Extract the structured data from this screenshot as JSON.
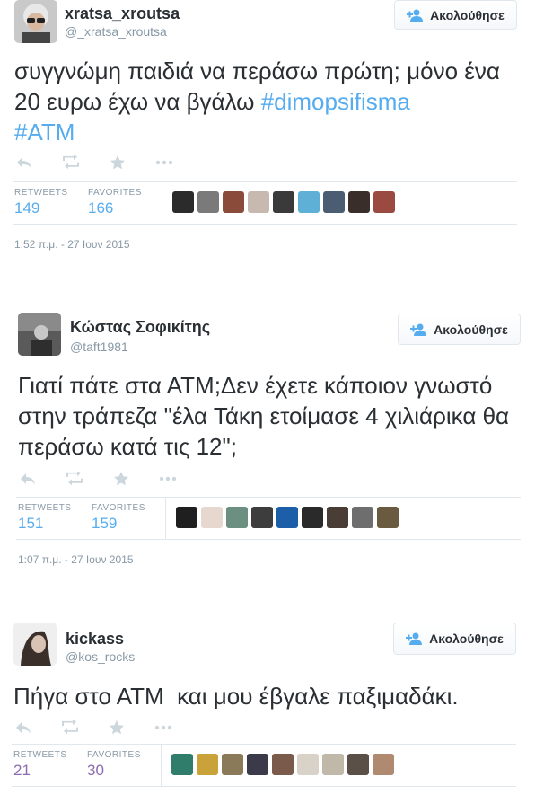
{
  "follow_label": "Ακολούθησε",
  "retweets_label": "RETWEETS",
  "favorites_label": "FAVORITES",
  "tweets": [
    {
      "name": "xratsa_xroutsa",
      "handle": "@_xratsa_xroutsa",
      "text_main": "συγγνώμη παιδιά να περάσω πρώτη; μόνο ένα 20 ευρω έχω να βγάλω ",
      "hashtag1": "#dimopsifisma",
      "hashtag2": "#ATM",
      "retweets": "149",
      "favorites": "166",
      "timestamp": "1:52 π.μ. - 27 Ιουν 2015"
    },
    {
      "name": "Κώστας Σοφικίτης",
      "handle": "@taft1981",
      "text_main": "Γιατί πάτε στα ΑΤΜ;Δεν έχετε κάποιον γνωστό στην τράπεζα \"έλα Τάκη ετοίμασε 4 χιλιάρικα θα περάσω κατά τις 12\";",
      "retweets": "151",
      "favorites": "159",
      "timestamp": "1:07 π.μ. - 27 Ιουν 2015"
    },
    {
      "name": "kickass",
      "handle": "@kos_rocks",
      "text_main": "Πήγα στο ΑΤΜ  και μου έβγαλε παξιμαδάκι.",
      "retweets": "21",
      "favorites": "30"
    }
  ],
  "colors": {
    "link": "#55acee",
    "muted": "#8899a6",
    "count_purple": "#8b6bb1",
    "border": "#e1e8ed"
  },
  "icons": {
    "reply": "reply-icon",
    "retweet": "retweet-icon",
    "favorite": "star-icon",
    "more": "more-icon",
    "follow": "add-user-icon"
  }
}
